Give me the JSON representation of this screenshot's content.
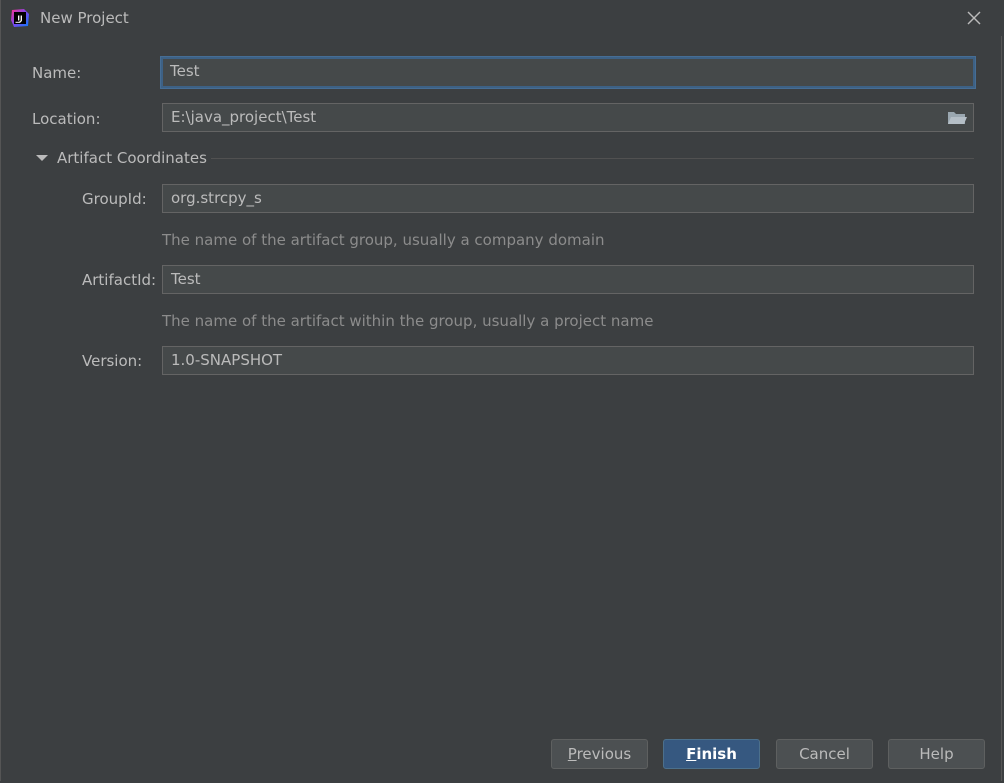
{
  "window": {
    "title": "New Project",
    "app_icon_text": "IJ"
  },
  "form": {
    "name_label": "Name:",
    "name_value": "Test",
    "location_label": "Location:",
    "location_value": "E:\\java_project\\Test",
    "section_title": "Artifact Coordinates",
    "group_label": "GroupId:",
    "group_value": "org.strcpy_s",
    "group_hint": "The name of the artifact group, usually a company domain",
    "artifact_label": "ArtifactId:",
    "artifact_value": "Test",
    "artifact_hint": "The name of the artifact within the group, usually a project name",
    "version_label": "Version:",
    "version_value": "1.0-SNAPSHOT"
  },
  "buttons": {
    "previous_mnemonic": "P",
    "previous_rest": "revious",
    "finish_mnemonic": "F",
    "finish_rest": "inish",
    "cancel": "Cancel",
    "help": "Help"
  },
  "colors": {
    "background": "#3c3f41",
    "field": "#45494a",
    "focus": "#3d6185",
    "primary_button": "#365880"
  }
}
